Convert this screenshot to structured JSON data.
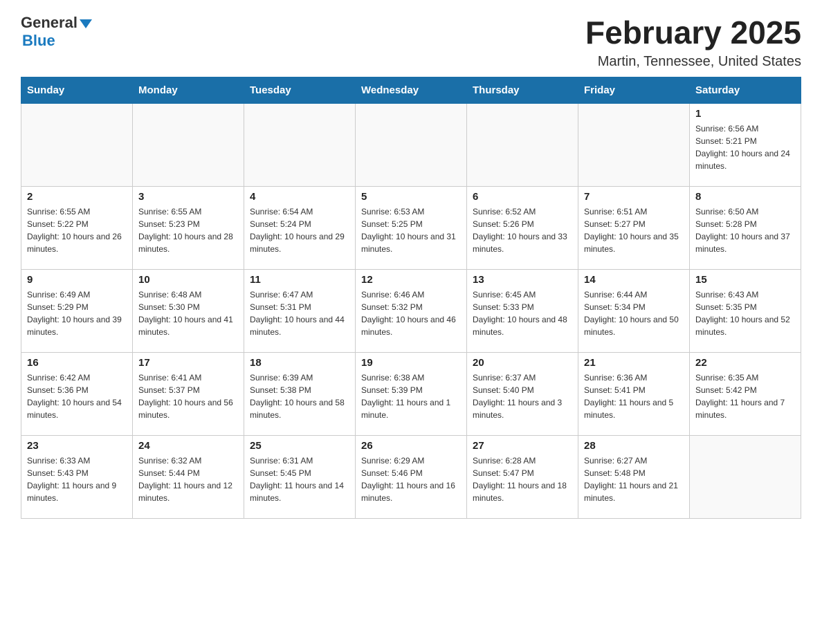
{
  "header": {
    "logo_general": "General",
    "logo_blue": "Blue",
    "title": "February 2025",
    "subtitle": "Martin, Tennessee, United States"
  },
  "weekdays": [
    "Sunday",
    "Monday",
    "Tuesday",
    "Wednesday",
    "Thursday",
    "Friday",
    "Saturday"
  ],
  "weeks": [
    [
      {
        "day": "",
        "info": ""
      },
      {
        "day": "",
        "info": ""
      },
      {
        "day": "",
        "info": ""
      },
      {
        "day": "",
        "info": ""
      },
      {
        "day": "",
        "info": ""
      },
      {
        "day": "",
        "info": ""
      },
      {
        "day": "1",
        "info": "Sunrise: 6:56 AM\nSunset: 5:21 PM\nDaylight: 10 hours and 24 minutes."
      }
    ],
    [
      {
        "day": "2",
        "info": "Sunrise: 6:55 AM\nSunset: 5:22 PM\nDaylight: 10 hours and 26 minutes."
      },
      {
        "day": "3",
        "info": "Sunrise: 6:55 AM\nSunset: 5:23 PM\nDaylight: 10 hours and 28 minutes."
      },
      {
        "day": "4",
        "info": "Sunrise: 6:54 AM\nSunset: 5:24 PM\nDaylight: 10 hours and 29 minutes."
      },
      {
        "day": "5",
        "info": "Sunrise: 6:53 AM\nSunset: 5:25 PM\nDaylight: 10 hours and 31 minutes."
      },
      {
        "day": "6",
        "info": "Sunrise: 6:52 AM\nSunset: 5:26 PM\nDaylight: 10 hours and 33 minutes."
      },
      {
        "day": "7",
        "info": "Sunrise: 6:51 AM\nSunset: 5:27 PM\nDaylight: 10 hours and 35 minutes."
      },
      {
        "day": "8",
        "info": "Sunrise: 6:50 AM\nSunset: 5:28 PM\nDaylight: 10 hours and 37 minutes."
      }
    ],
    [
      {
        "day": "9",
        "info": "Sunrise: 6:49 AM\nSunset: 5:29 PM\nDaylight: 10 hours and 39 minutes."
      },
      {
        "day": "10",
        "info": "Sunrise: 6:48 AM\nSunset: 5:30 PM\nDaylight: 10 hours and 41 minutes."
      },
      {
        "day": "11",
        "info": "Sunrise: 6:47 AM\nSunset: 5:31 PM\nDaylight: 10 hours and 44 minutes."
      },
      {
        "day": "12",
        "info": "Sunrise: 6:46 AM\nSunset: 5:32 PM\nDaylight: 10 hours and 46 minutes."
      },
      {
        "day": "13",
        "info": "Sunrise: 6:45 AM\nSunset: 5:33 PM\nDaylight: 10 hours and 48 minutes."
      },
      {
        "day": "14",
        "info": "Sunrise: 6:44 AM\nSunset: 5:34 PM\nDaylight: 10 hours and 50 minutes."
      },
      {
        "day": "15",
        "info": "Sunrise: 6:43 AM\nSunset: 5:35 PM\nDaylight: 10 hours and 52 minutes."
      }
    ],
    [
      {
        "day": "16",
        "info": "Sunrise: 6:42 AM\nSunset: 5:36 PM\nDaylight: 10 hours and 54 minutes."
      },
      {
        "day": "17",
        "info": "Sunrise: 6:41 AM\nSunset: 5:37 PM\nDaylight: 10 hours and 56 minutes."
      },
      {
        "day": "18",
        "info": "Sunrise: 6:39 AM\nSunset: 5:38 PM\nDaylight: 10 hours and 58 minutes."
      },
      {
        "day": "19",
        "info": "Sunrise: 6:38 AM\nSunset: 5:39 PM\nDaylight: 11 hours and 1 minute."
      },
      {
        "day": "20",
        "info": "Sunrise: 6:37 AM\nSunset: 5:40 PM\nDaylight: 11 hours and 3 minutes."
      },
      {
        "day": "21",
        "info": "Sunrise: 6:36 AM\nSunset: 5:41 PM\nDaylight: 11 hours and 5 minutes."
      },
      {
        "day": "22",
        "info": "Sunrise: 6:35 AM\nSunset: 5:42 PM\nDaylight: 11 hours and 7 minutes."
      }
    ],
    [
      {
        "day": "23",
        "info": "Sunrise: 6:33 AM\nSunset: 5:43 PM\nDaylight: 11 hours and 9 minutes."
      },
      {
        "day": "24",
        "info": "Sunrise: 6:32 AM\nSunset: 5:44 PM\nDaylight: 11 hours and 12 minutes."
      },
      {
        "day": "25",
        "info": "Sunrise: 6:31 AM\nSunset: 5:45 PM\nDaylight: 11 hours and 14 minutes."
      },
      {
        "day": "26",
        "info": "Sunrise: 6:29 AM\nSunset: 5:46 PM\nDaylight: 11 hours and 16 minutes."
      },
      {
        "day": "27",
        "info": "Sunrise: 6:28 AM\nSunset: 5:47 PM\nDaylight: 11 hours and 18 minutes."
      },
      {
        "day": "28",
        "info": "Sunrise: 6:27 AM\nSunset: 5:48 PM\nDaylight: 11 hours and 21 minutes."
      },
      {
        "day": "",
        "info": ""
      }
    ]
  ]
}
